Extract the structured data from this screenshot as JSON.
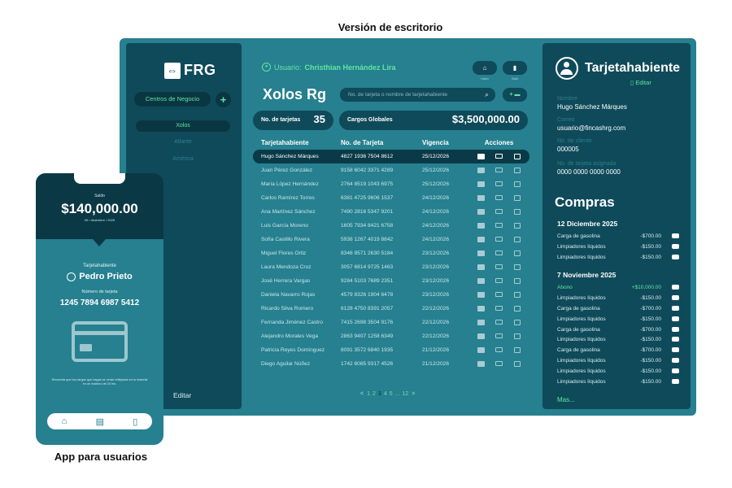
{
  "captions": {
    "desktop": "Versión de escritorio",
    "mobile": "App para usuarios"
  },
  "sidebar": {
    "logo": "FRG",
    "centros_label": "Centros de Negocio",
    "add": "+",
    "items": [
      {
        "label": "Xolos",
        "active": true
      },
      {
        "label": "Atlante"
      },
      {
        "label": "América"
      }
    ],
    "edit": "Editar"
  },
  "header": {
    "user_prefix": "Usuario:",
    "user_name": "Christhian Hernández Lira",
    "btn_inicio_label": "Inicio",
    "btn_salir_label": "Salir",
    "title": "Xolos Rg",
    "search_placeholder": "No. de tarjeta o nombre de tarjetahabiente",
    "add_card": "+"
  },
  "stats": {
    "cards_label": "No. de tarjetas",
    "cards_value": "35",
    "global_label": "Cargos Globales",
    "global_value": "$3,500,000.00"
  },
  "table": {
    "headers": [
      "Tarjetahabiente",
      "No. de Tarjeta",
      "Vigencia",
      "Acciones"
    ],
    "rows": [
      [
        "Hugo Sánchez Márques",
        "4827 1936 7504 8612",
        "25/12/2026"
      ],
      [
        "Juan Pérez González",
        "9158 6042 3371 4289",
        "25/12/2026"
      ],
      [
        "María López Hernández",
        "2764 8519 1043 6975",
        "25/12/2026"
      ],
      [
        "Carlos Ramírez Torres",
        "6381 4725 9606 1537",
        "24/12/2026"
      ],
      [
        "Ana Martínez Sánchez",
        "7490 2816 5347 9201",
        "24/12/2026"
      ],
      [
        "Luis García Moreno",
        "1605 7934 8421 6758",
        "24/12/2026"
      ],
      [
        "Sofía Castillo Rivera",
        "5938 1267 4019 8842",
        "24/12/2026"
      ],
      [
        "Miguel Flores Ortiz",
        "8346 9571 2630 5184",
        "23/12/2026"
      ],
      [
        "Laura Mendoza Cruz",
        "3057 6814 9725 1463",
        "23/12/2026"
      ],
      [
        "José Herrera Vargas",
        "9284 5103 7689 2351",
        "23/12/2026"
      ],
      [
        "Daniela Navarro Rojas",
        "4579 8326 1904 6478",
        "23/12/2026"
      ],
      [
        "Ricardo Silva Romero",
        "6128 4750 8391 2057",
        "22/12/2026"
      ],
      [
        "Fernanda Jiménez Castro",
        "7415 2698 3504 9176",
        "22/12/2026"
      ],
      [
        "Alejandro Morales Vega",
        "2863 9407 1258 6349",
        "22/12/2026"
      ],
      [
        "Patricia Reyes Domínguez",
        "8091 3572 6840 1935",
        "21/12/2026"
      ],
      [
        "Diego Aguilar Núñez",
        "1742 6085 9317 4526",
        "21/12/2026"
      ]
    ]
  },
  "pager": {
    "prev": "<",
    "pages": [
      "1",
      "2",
      "3",
      "4",
      "5",
      "...",
      "12"
    ],
    "current": "3",
    "next": ">"
  },
  "cardholder": {
    "title": "Tarjetahabiente",
    "edit": "Editar",
    "fields": [
      {
        "label": "Nombre",
        "value": "Hugo Sánchez Márques"
      },
      {
        "label": "Correo",
        "value": "usuario@fincashrg.com"
      },
      {
        "label": "No. de cliente",
        "value": "000005"
      },
      {
        "label": "No. de tarjeta asignada",
        "value": "0000 0000 0000 0000"
      }
    ]
  },
  "purchases": {
    "title": "Compras",
    "groups": [
      {
        "date": "12 Diciembre 2025",
        "items": [
          {
            "desc": "Carga de gasolina",
            "amount": "-$700.00"
          },
          {
            "desc": "Limpiadores líquidos",
            "amount": "-$150.00"
          },
          {
            "desc": "Limpiadores líquidos",
            "amount": "-$150.00"
          }
        ]
      },
      {
        "date": "7 Noviembre 2025",
        "items": [
          {
            "desc": "Abono",
            "amount": "+$10,000.00",
            "green": true
          },
          {
            "desc": "Limpiadores líquidos",
            "amount": "-$150.00"
          },
          {
            "desc": "Carga de gasolina",
            "amount": "-$700.00"
          },
          {
            "desc": "Limpiadores líquidos",
            "amount": "-$150.00"
          },
          {
            "desc": "Carga de gasolina",
            "amount": "-$700.00"
          },
          {
            "desc": "Limpiadores líquidos",
            "amount": "-$150.00"
          },
          {
            "desc": "Carga de gasolina",
            "amount": "-$700.00"
          },
          {
            "desc": "Limpiadores líquidos",
            "amount": "-$150.00"
          },
          {
            "desc": "Limpiadores líquidos",
            "amount": "-$150.00"
          },
          {
            "desc": "Limpiadores líquidos",
            "amount": "-$150.00"
          }
        ]
      }
    ],
    "more": "Mas..."
  },
  "mobile": {
    "saldo_label": "Saldo",
    "saldo": "$140,000.00",
    "date": "09 / diciembre / 2025",
    "cardholder_label": "Tarjetahabiente",
    "name": "Pedro Prieto",
    "card_label": "Número de tarjeta",
    "card_number": "1245 7894 6987 5412",
    "note": "Recuerda que los cargos que hagas se verán reflejados en tu historial en un máximo de 24 hrs."
  },
  "colors": {
    "dark": "#0f4a5a",
    "teal": "#26808f",
    "accent": "#5fe6a3"
  }
}
